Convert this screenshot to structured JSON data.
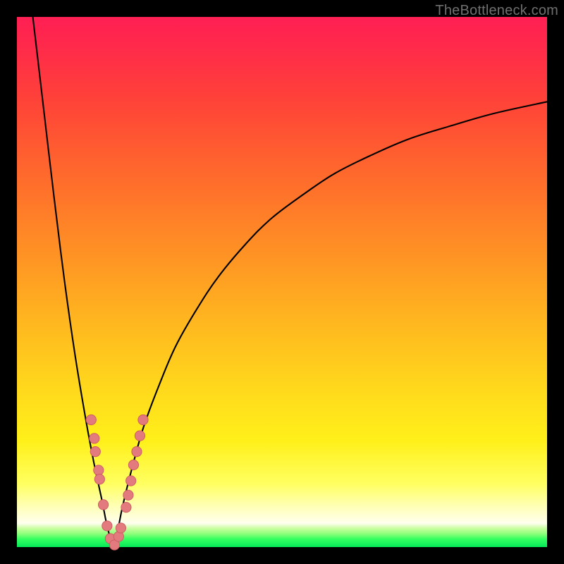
{
  "watermark": "TheBottleneck.com",
  "colors": {
    "frame_bg": "#000000",
    "curve_stroke": "#000000",
    "marker_fill": "#e27a7e",
    "marker_stroke": "#cc5a60"
  },
  "chart_data": {
    "type": "line",
    "title": "",
    "xlabel": "",
    "ylabel": "",
    "xlim": [
      0,
      100
    ],
    "ylim": [
      0,
      100
    ],
    "legend": false,
    "grid": false,
    "background": "vertical-gradient red→yellow→green",
    "series": [
      {
        "name": "left-branch",
        "comment": "Steep descending branch from top-left toward cusp near x≈18, y≈0",
        "x": [
          3,
          5,
          7,
          9,
          11,
          13,
          14.5,
          16,
          17,
          17.8,
          18.3
        ],
        "y": [
          100,
          83,
          66,
          50,
          36,
          24,
          16,
          9,
          4,
          1.2,
          0.2
        ]
      },
      {
        "name": "right-branch",
        "comment": "Rising branch from cusp, concave, approaching ~y≈84 at right edge",
        "x": [
          18.3,
          19,
          20,
          22,
          24,
          27,
          30,
          34,
          38,
          43,
          48,
          54,
          60,
          67,
          74,
          82,
          90,
          100
        ],
        "y": [
          0.2,
          3,
          8,
          16,
          23,
          31,
          38,
          45,
          51,
          57,
          62,
          66.5,
          70.5,
          74,
          77,
          79.5,
          81.8,
          84
        ]
      }
    ],
    "markers": {
      "comment": "Pink-red circular data markers clustered around the cusp region (approx x 14–24, y 0–24)",
      "points": [
        {
          "x": 14.0,
          "y": 24.0
        },
        {
          "x": 14.6,
          "y": 20.5
        },
        {
          "x": 14.8,
          "y": 18.0
        },
        {
          "x": 15.4,
          "y": 14.5
        },
        {
          "x": 15.6,
          "y": 12.8
        },
        {
          "x": 16.3,
          "y": 8.0
        },
        {
          "x": 17.0,
          "y": 4.0
        },
        {
          "x": 17.6,
          "y": 1.6
        },
        {
          "x": 18.4,
          "y": 0.4
        },
        {
          "x": 19.2,
          "y": 2.0
        },
        {
          "x": 19.6,
          "y": 3.6
        },
        {
          "x": 20.6,
          "y": 7.5
        },
        {
          "x": 21.0,
          "y": 9.8
        },
        {
          "x": 21.5,
          "y": 12.5
        },
        {
          "x": 22.0,
          "y": 15.5
        },
        {
          "x": 22.6,
          "y": 18.0
        },
        {
          "x": 23.2,
          "y": 21.0
        },
        {
          "x": 23.8,
          "y": 24.0
        }
      ]
    }
  }
}
